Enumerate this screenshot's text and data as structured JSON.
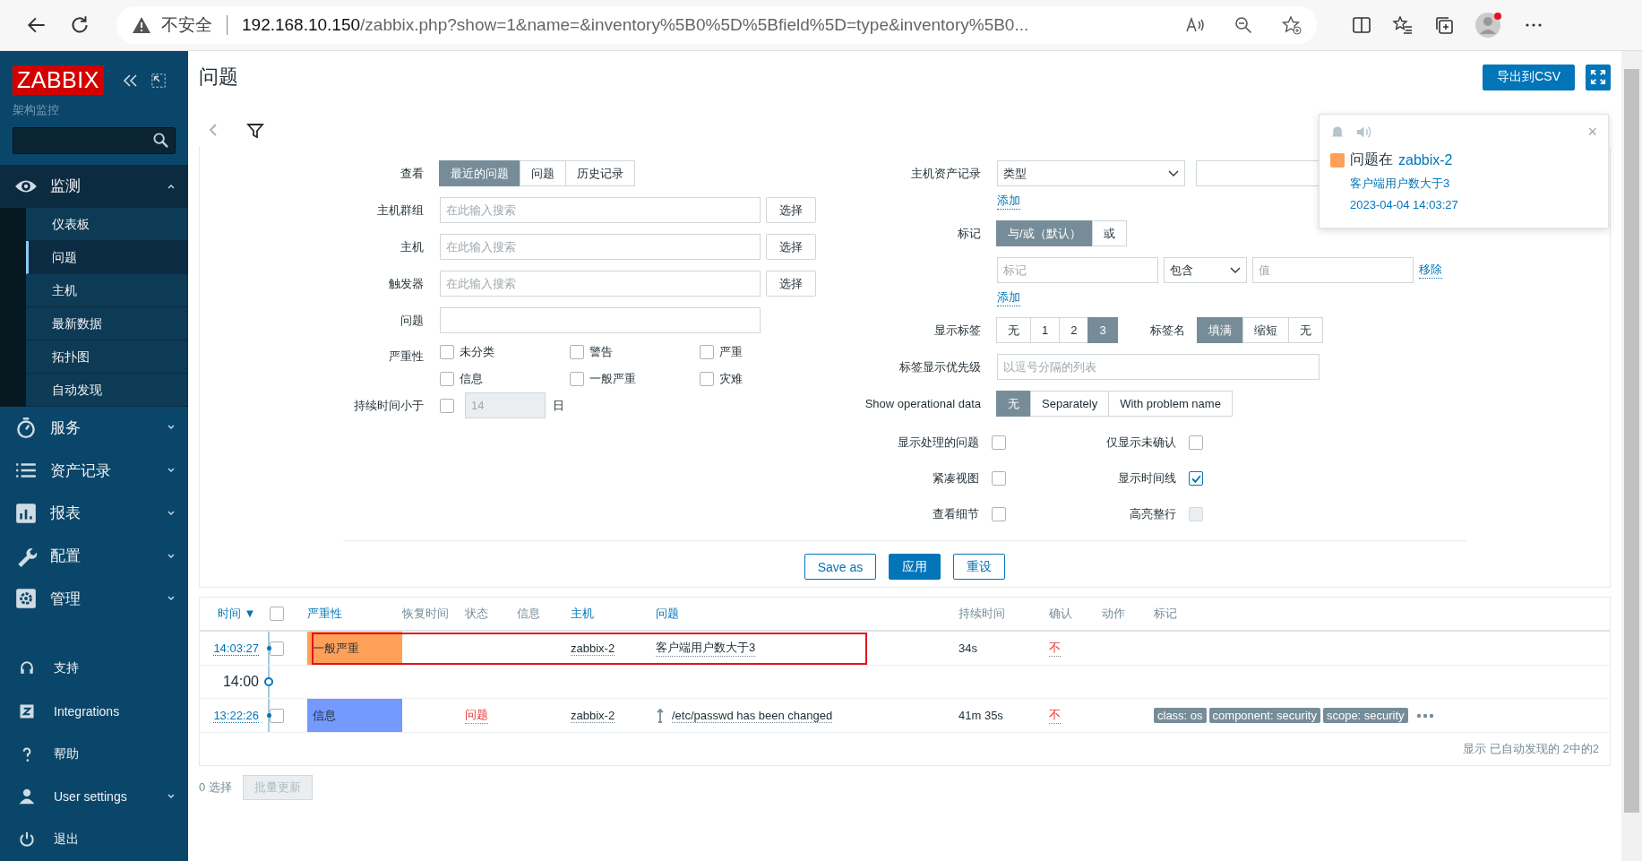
{
  "browser": {
    "security": "不安全",
    "host": "192.168.10.150",
    "path": "/zabbix.php?show=1&name=&inventory%5B0%5D%5Bfield%5D=type&inventory%5B0..."
  },
  "sidebar": {
    "logo": "ZABBIX",
    "subtitle": "架构监控",
    "menu": [
      {
        "label": "监测",
        "expanded": true,
        "children": [
          {
            "label": "仪表板",
            "selected": false
          },
          {
            "label": "问题",
            "selected": true
          },
          {
            "label": "主机",
            "selected": false
          },
          {
            "label": "最新数据",
            "selected": false
          },
          {
            "label": "拓扑图",
            "selected": false
          },
          {
            "label": "自动发现",
            "selected": false
          }
        ]
      },
      {
        "label": "服务",
        "expanded": false
      },
      {
        "label": "资产记录",
        "expanded": false
      },
      {
        "label": "报表",
        "expanded": false
      },
      {
        "label": "配置",
        "expanded": false
      },
      {
        "label": "管理",
        "expanded": false
      }
    ],
    "bottom": [
      {
        "label": "支持",
        "has_menu": false
      },
      {
        "label": "Integrations",
        "has_menu": false
      },
      {
        "label": "帮助",
        "has_menu": false
      },
      {
        "label": "User settings",
        "has_menu": true
      },
      {
        "label": "退出",
        "has_menu": false
      }
    ]
  },
  "page": {
    "title": "问题",
    "export_button": "导出到CSV"
  },
  "filter": {
    "view": {
      "label": "查看",
      "options": [
        {
          "label": "最近的问题",
          "selected": true
        },
        {
          "label": "问题",
          "selected": false
        },
        {
          "label": "历史记录",
          "selected": false
        }
      ]
    },
    "pickers": [
      {
        "label": "主机群组",
        "placeholder": "在此输入搜索",
        "button": "选择"
      },
      {
        "label": "主机",
        "placeholder": "在此输入搜索",
        "button": "选择"
      },
      {
        "label": "触发器",
        "placeholder": "在此输入搜索",
        "button": "选择"
      }
    ],
    "problem": {
      "label": "问题"
    },
    "severity": {
      "label": "严重性",
      "options": [
        {
          "label": "未分类",
          "checked": false
        },
        {
          "label": "警告",
          "checked": false
        },
        {
          "label": "严重",
          "checked": false
        },
        {
          "label": "信息",
          "checked": false
        },
        {
          "label": "一般严重",
          "checked": false
        },
        {
          "label": "灾难",
          "checked": false
        }
      ]
    },
    "age": {
      "label": "持续时间小于",
      "checked": false,
      "value": "14",
      "unit": "日"
    },
    "inventory": {
      "label": "主机资产记录",
      "field": "类型",
      "add": "添加"
    },
    "tags": {
      "label": "标记",
      "modes": [
        {
          "label": "与/或（默认）",
          "selected": true
        },
        {
          "label": "或",
          "selected": false
        }
      ],
      "tag_placeholder": "标记",
      "operator": "包含",
      "value_placeholder": "值",
      "remove": "移除",
      "add": "添加"
    },
    "show_tags": {
      "label": "显示标签",
      "options": [
        {
          "label": "无",
          "selected": false
        },
        {
          "label": "1",
          "selected": false
        },
        {
          "label": "2",
          "selected": false
        },
        {
          "label": "3",
          "selected": true
        }
      ]
    },
    "tag_name": {
      "label": "标签名",
      "options": [
        {
          "label": "填满",
          "selected": true
        },
        {
          "label": "缩短",
          "selected": false
        },
        {
          "label": "无",
          "selected": false
        }
      ]
    },
    "tag_priority": {
      "label": "标签显示优先级",
      "placeholder": "以逗号分隔的列表"
    },
    "operational": {
      "label": "Show operational data",
      "options": [
        {
          "label": "无",
          "selected": true
        },
        {
          "label": "Separately",
          "selected": false
        },
        {
          "label": "With problem name",
          "selected": false
        }
      ]
    },
    "toggles": [
      {
        "label": "显示处理的问题",
        "checked": false,
        "disabled": false
      },
      {
        "label": "仅显示未确认",
        "checked": false,
        "disabled": false
      },
      {
        "label": "紧凑视图",
        "checked": false,
        "disabled": false
      },
      {
        "label": "显示时间线",
        "checked": true,
        "disabled": false
      },
      {
        "label": "查看细节",
        "checked": false,
        "disabled": false
      },
      {
        "label": "高亮整行",
        "checked": false,
        "disabled": true
      }
    ],
    "buttons": [
      {
        "label": "Save as",
        "kind": "outline"
      },
      {
        "label": "应用",
        "kind": "primary"
      },
      {
        "label": "重设",
        "kind": "outline"
      }
    ]
  },
  "table": {
    "columns": [
      {
        "label": "时间 ▼",
        "link": true
      },
      {
        "kind": "checkbox",
        "checked": false
      },
      {
        "label": "严重性",
        "link": true
      },
      {
        "label": "恢复时间",
        "link": false
      },
      {
        "label": "状态",
        "link": false
      },
      {
        "label": "信息",
        "link": false
      },
      {
        "label": "主机",
        "link": true
      },
      {
        "label": "问题",
        "link": true
      },
      {
        "label": "持续时间",
        "link": false
      },
      {
        "label": "确认",
        "link": false
      },
      {
        "label": "动作",
        "link": false
      },
      {
        "label": "标记",
        "link": false
      }
    ],
    "rows": [
      {
        "kind": "problem",
        "time": "14:03:27",
        "checked": false,
        "severity": "一般严重",
        "color": "#ffa059",
        "status": "",
        "host": "zabbix-2",
        "problem": "客户端用户数大于3",
        "dependency": false,
        "duration": "34s",
        "ack": "不",
        "tags": [],
        "outlined": true
      },
      {
        "kind": "divider",
        "time": "14:00"
      },
      {
        "kind": "problem",
        "time": "13:22:26",
        "checked": false,
        "severity": "信息",
        "color": "#7499ff",
        "status": "问题",
        "host": "zabbix-2",
        "problem": "/etc/passwd has been changed",
        "dependency": true,
        "duration": "41m 35s",
        "ack": "不",
        "tags": [
          "class: os",
          "component: security",
          "scope: security"
        ],
        "outlined": false
      }
    ],
    "footer": "显示 已自动发现的 2中的2"
  },
  "actions": {
    "selected": "0 选择",
    "mass_update": "批量更新"
  },
  "notification": {
    "title": "问题在",
    "host": "zabbix-2",
    "problem": "客户端用户数大于3",
    "time": "2023-04-04 14:03:27",
    "color": "#ffa059",
    "close": "×"
  }
}
